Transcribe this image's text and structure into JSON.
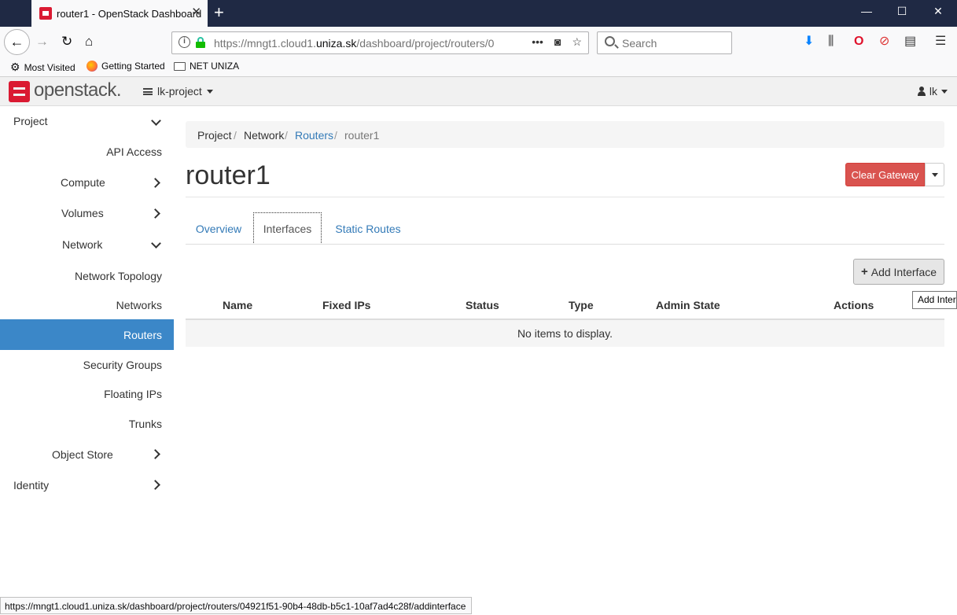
{
  "browser": {
    "tab_title": "router1 - OpenStack Dashboard",
    "url_prefix": "https://mngt1.cloud1.",
    "url_domain": "uniza.sk",
    "url_suffix": "/dashboard/project/routers/0",
    "search_placeholder": "Search",
    "bookmarks": [
      "Most Visited",
      "Getting Started",
      "NET UNIZA"
    ],
    "status_url": "https://mngt1.cloud1.uniza.sk/dashboard/project/routers/04921f51-90b4-48db-b5c1-10af7ad4c28f/addinterface"
  },
  "header": {
    "logo": "openstack.",
    "project": "lk-project",
    "user": "lk"
  },
  "sidebar": {
    "items": [
      {
        "label": "Project",
        "chevron": "down"
      },
      {
        "label": "API Access"
      },
      {
        "label": "Compute",
        "chevron": "right"
      },
      {
        "label": "Volumes",
        "chevron": "right"
      },
      {
        "label": "Network",
        "chevron": "down"
      },
      {
        "label": "Network Topology"
      },
      {
        "label": "Networks"
      },
      {
        "label": "Routers",
        "active": true
      },
      {
        "label": "Security Groups"
      },
      {
        "label": "Floating IPs"
      },
      {
        "label": "Trunks"
      },
      {
        "label": "Object Store",
        "chevron": "right"
      },
      {
        "label": "Identity",
        "chevron": "right"
      }
    ]
  },
  "breadcrumb": [
    "Project",
    "Network",
    "Routers",
    "router1"
  ],
  "page": {
    "title": "router1",
    "clear_gateway": "Clear Gateway",
    "tabs": [
      "Overview",
      "Interfaces",
      "Static Routes"
    ],
    "active_tab": "Interfaces",
    "add_interface": "Add Interface",
    "tooltip": "Add Inter"
  },
  "table": {
    "columns": [
      "Name",
      "Fixed IPs",
      "Status",
      "Type",
      "Admin State",
      "Actions"
    ],
    "empty_message": "No items to display."
  },
  "colors": {
    "accent": "#3b87c8",
    "danger": "#d9534f",
    "brand": "#da1a32",
    "link": "#337ab7"
  }
}
